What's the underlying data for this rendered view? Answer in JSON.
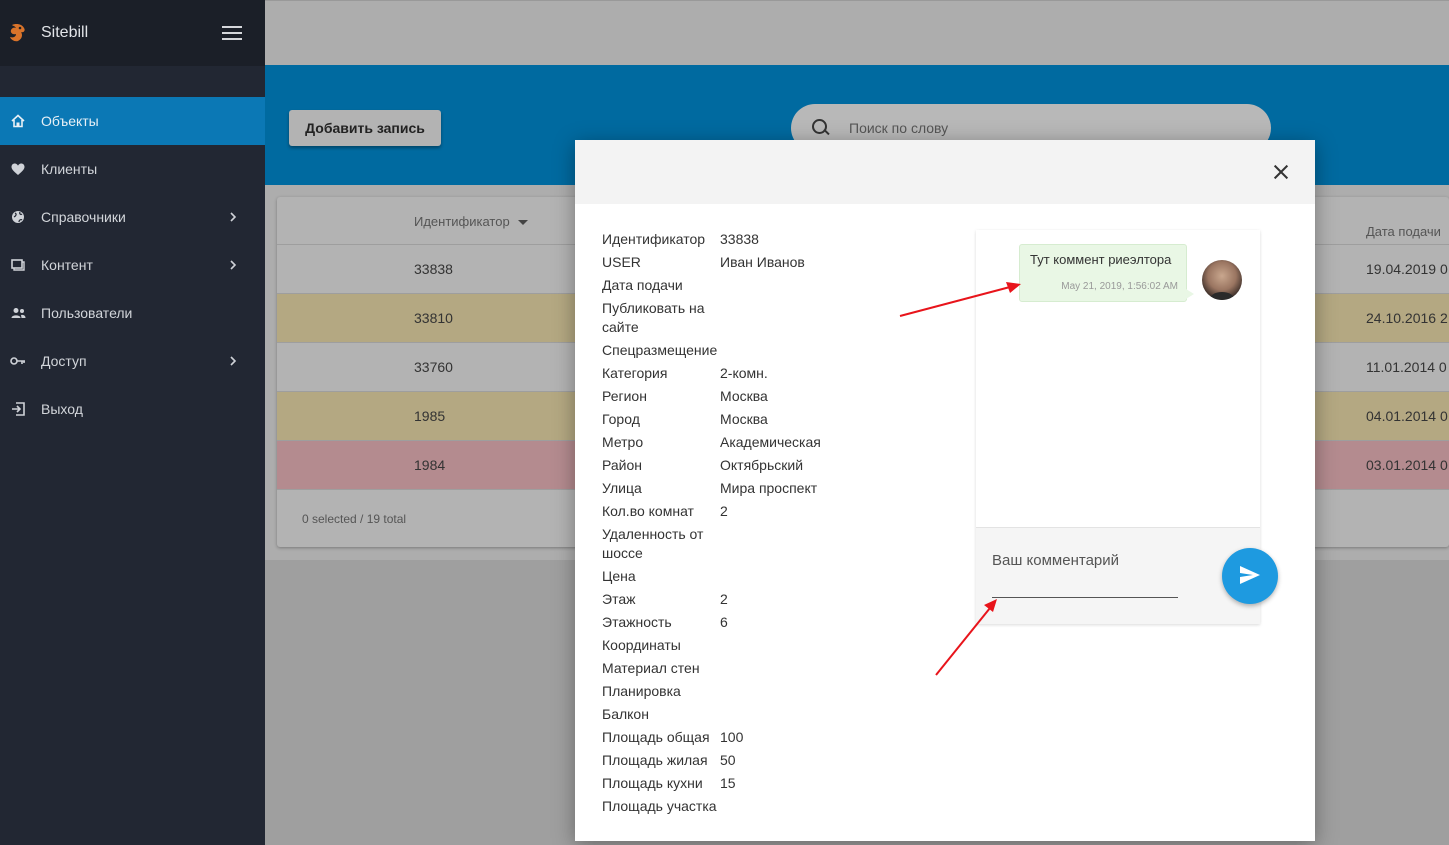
{
  "app": {
    "brand": "Sitebill"
  },
  "sidebar": {
    "items": [
      {
        "label": "Объекты",
        "icon": "home-icon",
        "active": true,
        "has_children": false
      },
      {
        "label": "Клиенты",
        "icon": "heart-icon",
        "active": false,
        "has_children": false
      },
      {
        "label": "Справочники",
        "icon": "globe-icon",
        "active": false,
        "has_children": true
      },
      {
        "label": "Контент",
        "icon": "content-icon",
        "active": false,
        "has_children": true
      },
      {
        "label": "Пользователи",
        "icon": "users-icon",
        "active": false,
        "has_children": false
      },
      {
        "label": "Доступ",
        "icon": "key-icon",
        "active": false,
        "has_children": true
      },
      {
        "label": "Выход",
        "icon": "exit-icon",
        "active": false,
        "has_children": false
      }
    ]
  },
  "toolbar": {
    "add_label": "Добавить запись"
  },
  "search": {
    "placeholder": "Поиск по слову"
  },
  "table": {
    "columns": {
      "id": "Идентификатор",
      "date": "Дата подачи"
    },
    "rows": [
      {
        "id": "33838",
        "date": "19.04.2019 0"
      },
      {
        "id": "33810",
        "date": "24.10.2016 2"
      },
      {
        "id": "33760",
        "date": "11.01.2014 0"
      },
      {
        "id": "1985",
        "date": "04.01.2014 0"
      },
      {
        "id": "1984",
        "date": "03.01.2014 0"
      }
    ],
    "footer": "0 selected / 19 total"
  },
  "modal": {
    "fields": [
      {
        "label": "Идентификатор",
        "value": "33838"
      },
      {
        "label": "USER",
        "value": "Иван Иванов"
      },
      {
        "label": "Дата подачи",
        "value": ""
      },
      {
        "label": "Публиковать на сайте",
        "value": ""
      },
      {
        "label": "Спецразмещение",
        "value": ""
      },
      {
        "label": "Категория",
        "value": "2-комн."
      },
      {
        "label": "Регион",
        "value": "Москва"
      },
      {
        "label": "Город",
        "value": "Москва"
      },
      {
        "label": "Метро",
        "value": "Академическая"
      },
      {
        "label": "Район",
        "value": "Октябрьский"
      },
      {
        "label": "Улица",
        "value": "Мира проспект"
      },
      {
        "label": "Кол.во комнат",
        "value": "2"
      },
      {
        "label": "Удаленность от шоссе",
        "value": ""
      },
      {
        "label": "Цена",
        "value": ""
      },
      {
        "label": "Этаж",
        "value": "2"
      },
      {
        "label": "Этажность",
        "value": "6"
      },
      {
        "label": "Координаты",
        "value": ""
      },
      {
        "label": "Материал стен",
        "value": ""
      },
      {
        "label": "Планировка",
        "value": ""
      },
      {
        "label": "Балкон",
        "value": ""
      },
      {
        "label": "Площадь общая",
        "value": "100"
      },
      {
        "label": "Площадь жилая",
        "value": "50"
      },
      {
        "label": "Площадь кухни",
        "value": "15"
      },
      {
        "label": "Площадь участка",
        "value": ""
      }
    ],
    "chat": {
      "message": {
        "text": "Тут коммент риеэлтора",
        "time": "May 21, 2019, 1:56:02 AM"
      },
      "comment_placeholder": "Ваш комментарий"
    }
  },
  "colors": {
    "accent": "#0b78b5",
    "send": "#1e9ae0",
    "arrow": "#e8141b"
  }
}
